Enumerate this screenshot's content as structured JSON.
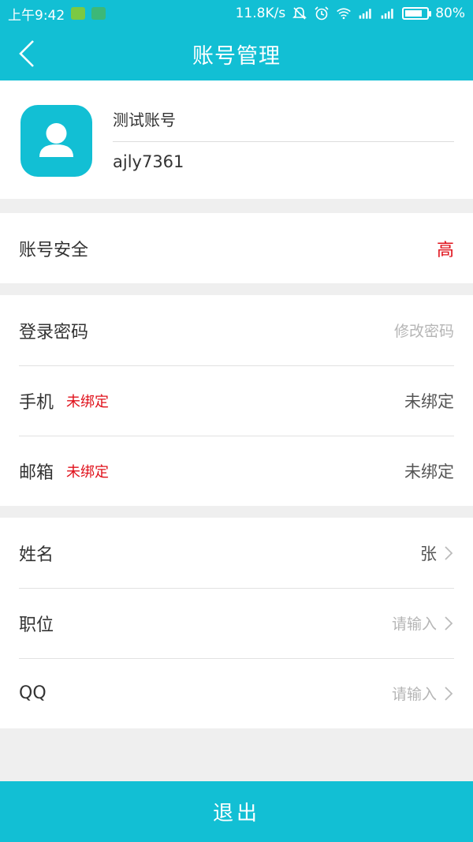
{
  "status_bar": {
    "time": "上午9:42",
    "network_speed": "11.8K/s",
    "battery": "80%",
    "battery_level": 0.8
  },
  "header": {
    "title": "账号管理"
  },
  "profile": {
    "nickname": "测试账号",
    "account_id": "ajly7361"
  },
  "security": {
    "label": "账号安全",
    "value": "高"
  },
  "bindings": {
    "password": {
      "label": "登录密码",
      "value": "修改密码"
    },
    "phone": {
      "label": "手机",
      "tag": "未绑定",
      "value": "未绑定"
    },
    "email": {
      "label": "邮箱",
      "tag": "未绑定",
      "value": "未绑定"
    }
  },
  "info": {
    "name": {
      "label": "姓名",
      "value": "张"
    },
    "position": {
      "label": "职位",
      "placeholder": "请输入"
    },
    "qq": {
      "label": "QQ",
      "placeholder": "请输入"
    }
  },
  "actions": {
    "logout_label": "退出"
  },
  "colors": {
    "accent": "#12bfd4",
    "alert": "#e0101a"
  }
}
